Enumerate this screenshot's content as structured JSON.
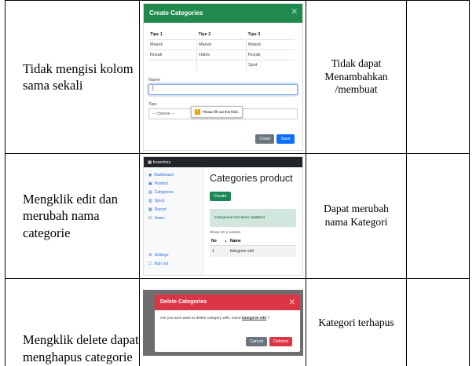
{
  "rows": [
    {
      "scenario": "Tidak mengisi kolom sama sekali",
      "result": "Tidak dapat Menambahkan /membuat"
    },
    {
      "scenario": "Mengklik edit dan merubah nama categorie",
      "result": "Dapat merubah nama Kategori"
    },
    {
      "scenario": "Mengklik delete dapat menghapus categorie",
      "result": "Kategori terhapus"
    }
  ],
  "create_modal": {
    "title": "Create Categories",
    "headers": [
      "Tipe 1",
      "Tipe 2",
      "Tipe 3"
    ],
    "table": [
      [
        "Masuk",
        "Masuk",
        "Masuk"
      ],
      [
        "Rusak",
        "Habis",
        "Rusak"
      ],
      [
        "",
        "",
        "Spot"
      ]
    ],
    "name_label": "Name",
    "name_value": "|",
    "tooltip": "Please fill out this field.",
    "type_label": "Tipe",
    "type_select": "-- choose --",
    "close_btn": "Close",
    "save_btn": "Save"
  },
  "dashboard": {
    "brand": "Inventory",
    "nav": [
      {
        "icon": "dashboard-icon",
        "glyph": "◉",
        "label": "Dashboard"
      },
      {
        "icon": "product-icon",
        "glyph": "▣",
        "label": "Product"
      },
      {
        "icon": "categories-icon",
        "glyph": "▤",
        "label": "Categories"
      },
      {
        "icon": "stock-icon",
        "glyph": "▥",
        "label": "Stock"
      },
      {
        "icon": "report-icon",
        "glyph": "▦",
        "label": "Report"
      },
      {
        "icon": "users-icon",
        "glyph": "☷",
        "label": "Users"
      }
    ],
    "settings": "Settings",
    "signout": "Sign out",
    "page_title": "Categories product",
    "create_btn": "Create",
    "alert": "Categories has been Updated",
    "show_entries": "Show 10 ∨ entries",
    "col_no": "No",
    "col_sort": "▲",
    "col_name": "Name",
    "row_no": "1",
    "row_name": "kategorie edit"
  },
  "delete_modal": {
    "title": "Delete Categories",
    "body_prefix": "Are you sure want to delete category with, name ",
    "body_name": "kategorie edit",
    "body_suffix": " ?",
    "cancel_btn": "Cancel",
    "delete_btn": "Deleted"
  }
}
